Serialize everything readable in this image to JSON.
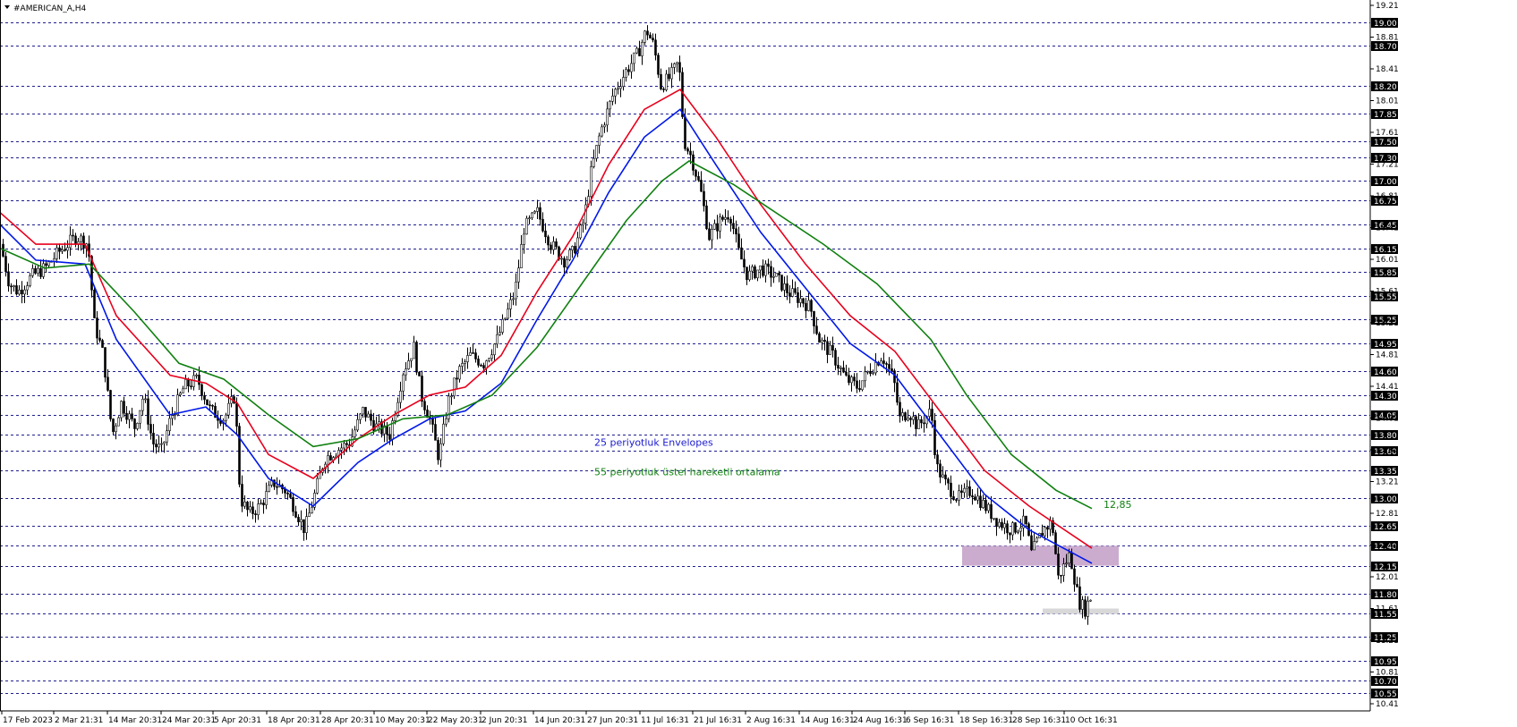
{
  "chart_data": {
    "type": "candlestick",
    "title": "#AMERICAN_A,H4",
    "ylim": [
      10.41,
      19.21
    ],
    "y_scale_labels": [
      "19.21",
      "18.81",
      "18.41",
      "18.01",
      "17.61",
      "17.21",
      "16.81",
      "16.41",
      "16.01",
      "15.61",
      "15.21",
      "14.81",
      "14.41",
      "14.01",
      "13.61",
      "13.21",
      "12.81",
      "12.41",
      "12.01",
      "11.61",
      "11.21",
      "10.81",
      "10.41"
    ],
    "level_lines": [
      19.0,
      18.7,
      18.2,
      17.85,
      17.5,
      17.3,
      17.0,
      16.75,
      16.45,
      16.15,
      15.85,
      15.55,
      15.25,
      14.95,
      14.6,
      14.3,
      14.05,
      13.8,
      13.6,
      13.35,
      13.0,
      12.65,
      12.4,
      12.15,
      11.8,
      11.55,
      11.25,
      10.95,
      10.7,
      10.55
    ],
    "x_labels": [
      "17 Feb 2023",
      "2 Mar 21:31",
      "14 Mar 20:31",
      "24 Mar 20:31",
      "5 Apr 20:31",
      "18 Apr 20:31",
      "28 Apr 20:31",
      "10 May 20:31",
      "22 May 20:31",
      "2 Jun 20:31",
      "14 Jun 20:31",
      "27 Jun 20:31",
      "11 Jul 16:31",
      "21 Jul 16:31",
      "2 Aug 16:31",
      "14 Aug 16:31",
      "24 Aug 16:31",
      "6 Sep 16:31",
      "18 Sep 16:31",
      "28 Sep 16:31",
      "10 Oct 16:31"
    ],
    "price_path": [
      [
        0,
        16.2
      ],
      [
        10,
        15.7
      ],
      [
        20,
        15.6
      ],
      [
        35,
        15.8
      ],
      [
        50,
        15.9
      ],
      [
        65,
        16.1
      ],
      [
        85,
        16.3
      ],
      [
        98,
        16.2
      ],
      [
        105,
        15.2
      ],
      [
        115,
        14.8
      ],
      [
        125,
        13.8
      ],
      [
        135,
        14.2
      ],
      [
        150,
        13.9
      ],
      [
        160,
        14.3
      ],
      [
        170,
        13.7
      ],
      [
        180,
        13.6
      ],
      [
        190,
        14.0
      ],
      [
        205,
        14.4
      ],
      [
        220,
        14.5
      ],
      [
        235,
        14.1
      ],
      [
        250,
        14.0
      ],
      [
        262,
        14.3
      ],
      [
        268,
        13.0
      ],
      [
        278,
        12.8
      ],
      [
        290,
        12.9
      ],
      [
        305,
        13.2
      ],
      [
        318,
        13.1
      ],
      [
        328,
        12.9
      ],
      [
        340,
        12.6
      ],
      [
        350,
        13.0
      ],
      [
        362,
        13.5
      ],
      [
        375,
        13.6
      ],
      [
        390,
        13.7
      ],
      [
        405,
        14.1
      ],
      [
        420,
        13.9
      ],
      [
        435,
        13.8
      ],
      [
        450,
        14.6
      ],
      [
        462,
        14.9
      ],
      [
        470,
        14.3
      ],
      [
        480,
        14.0
      ],
      [
        490,
        13.5
      ],
      [
        500,
        14.2
      ],
      [
        512,
        14.6
      ],
      [
        525,
        14.8
      ],
      [
        540,
        14.7
      ],
      [
        555,
        15.0
      ],
      [
        565,
        15.3
      ],
      [
        575,
        15.6
      ],
      [
        585,
        16.4
      ],
      [
        600,
        16.6
      ],
      [
        615,
        16.2
      ],
      [
        630,
        16.0
      ],
      [
        640,
        16.1
      ],
      [
        652,
        16.5
      ],
      [
        660,
        17.1
      ],
      [
        670,
        17.6
      ],
      [
        685,
        18.1
      ],
      [
        700,
        18.4
      ],
      [
        712,
        18.6
      ],
      [
        722,
        18.9
      ],
      [
        730,
        18.7
      ],
      [
        738,
        18.2
      ],
      [
        748,
        18.3
      ],
      [
        758,
        18.5
      ],
      [
        764,
        17.5
      ],
      [
        772,
        17.3
      ],
      [
        782,
        16.9
      ],
      [
        792,
        16.3
      ],
      [
        805,
        16.5
      ],
      [
        815,
        16.6
      ],
      [
        825,
        16.1
      ],
      [
        835,
        15.8
      ],
      [
        850,
        15.9
      ],
      [
        865,
        15.8
      ],
      [
        880,
        15.6
      ],
      [
        895,
        15.5
      ],
      [
        905,
        15.4
      ],
      [
        915,
        15.0
      ],
      [
        930,
        14.8
      ],
      [
        945,
        14.5
      ],
      [
        958,
        14.4
      ],
      [
        970,
        14.6
      ],
      [
        985,
        14.8
      ],
      [
        998,
        14.5
      ],
      [
        1005,
        14.0
      ],
      [
        1015,
        14.1
      ],
      [
        1025,
        13.9
      ],
      [
        1040,
        14.1
      ],
      [
        1046,
        13.4
      ],
      [
        1055,
        13.2
      ],
      [
        1070,
        13.0
      ],
      [
        1085,
        13.1
      ],
      [
        1100,
        12.9
      ],
      [
        1115,
        12.7
      ],
      [
        1130,
        12.6
      ],
      [
        1145,
        12.7
      ],
      [
        1152,
        12.3
      ],
      [
        1165,
        12.6
      ],
      [
        1175,
        12.7
      ],
      [
        1182,
        12.0
      ],
      [
        1195,
        12.3
      ],
      [
        1205,
        11.7
      ],
      [
        1212,
        11.6
      ],
      [
        1218,
        11.75
      ]
    ],
    "series": [
      {
        "name": "",
        "color": "#e8001c",
        "points": [
          [
            0,
            16.6
          ],
          [
            40,
            16.2
          ],
          [
            95,
            16.2
          ],
          [
            130,
            15.3
          ],
          [
            190,
            14.55
          ],
          [
            230,
            14.45
          ],
          [
            265,
            14.2
          ],
          [
            300,
            13.55
          ],
          [
            350,
            13.25
          ],
          [
            400,
            13.75
          ],
          [
            440,
            14.05
          ],
          [
            480,
            14.3
          ],
          [
            520,
            14.4
          ],
          [
            560,
            14.8
          ],
          [
            600,
            15.6
          ],
          [
            640,
            16.3
          ],
          [
            680,
            17.2
          ],
          [
            720,
            17.9
          ],
          [
            760,
            18.15
          ],
          [
            800,
            17.55
          ],
          [
            850,
            16.7
          ],
          [
            900,
            15.95
          ],
          [
            950,
            15.3
          ],
          [
            1000,
            14.85
          ],
          [
            1050,
            14.1
          ],
          [
            1100,
            13.35
          ],
          [
            1150,
            12.9
          ],
          [
            1220,
            12.37
          ]
        ]
      },
      {
        "name": "",
        "color": "#0018e8",
        "points": [
          [
            0,
            16.45
          ],
          [
            40,
            16.0
          ],
          [
            95,
            15.95
          ],
          [
            130,
            15.0
          ],
          [
            190,
            14.05
          ],
          [
            230,
            14.15
          ],
          [
            265,
            13.8
          ],
          [
            300,
            13.25
          ],
          [
            350,
            12.9
          ],
          [
            400,
            13.45
          ],
          [
            440,
            13.75
          ],
          [
            480,
            14.0
          ],
          [
            520,
            14.1
          ],
          [
            560,
            14.45
          ],
          [
            600,
            15.25
          ],
          [
            640,
            16.0
          ],
          [
            680,
            16.85
          ],
          [
            720,
            17.55
          ],
          [
            760,
            17.9
          ],
          [
            800,
            17.2
          ],
          [
            850,
            16.35
          ],
          [
            900,
            15.65
          ],
          [
            950,
            14.95
          ],
          [
            1000,
            14.55
          ],
          [
            1050,
            13.8
          ],
          [
            1100,
            13.05
          ],
          [
            1150,
            12.6
          ],
          [
            1220,
            12.18
          ]
        ]
      },
      {
        "name": "",
        "color": "#108010",
        "points": [
          [
            0,
            16.15
          ],
          [
            50,
            15.9
          ],
          [
            100,
            15.95
          ],
          [
            150,
            15.35
          ],
          [
            200,
            14.7
          ],
          [
            250,
            14.5
          ],
          [
            300,
            14.05
          ],
          [
            350,
            13.65
          ],
          [
            400,
            13.75
          ],
          [
            450,
            14.0
          ],
          [
            500,
            14.05
          ],
          [
            550,
            14.3
          ],
          [
            600,
            14.9
          ],
          [
            650,
            15.7
          ],
          [
            700,
            16.5
          ],
          [
            740,
            17.0
          ],
          [
            770,
            17.25
          ],
          [
            820,
            16.95
          ],
          [
            860,
            16.65
          ],
          [
            920,
            16.2
          ],
          [
            980,
            15.7
          ],
          [
            1040,
            15.0
          ],
          [
            1080,
            14.3
          ],
          [
            1130,
            13.55
          ],
          [
            1180,
            13.1
          ],
          [
            1220,
            12.87
          ]
        ]
      }
    ],
    "support_zones": [
      {
        "from": 1075,
        "to": 1250,
        "low": 12.15,
        "high": 12.4,
        "color": "#c8a8cc"
      },
      {
        "from": 1165,
        "to": 1250,
        "low": 11.54,
        "high": 11.61,
        "color": "#d6d6d6"
      }
    ],
    "annotations": [
      {
        "text": "25 periyotluk Envelopes",
        "color": "#1a1ad0",
        "x": 664,
        "y": 13.66
      },
      {
        "text": "55 periyotluk üstel hareketli ortalama",
        "color": "#108010",
        "x": 664,
        "y": 13.29
      },
      {
        "text": "12,85",
        "color": "#108010",
        "x": 1233,
        "y": 12.88
      }
    ]
  }
}
